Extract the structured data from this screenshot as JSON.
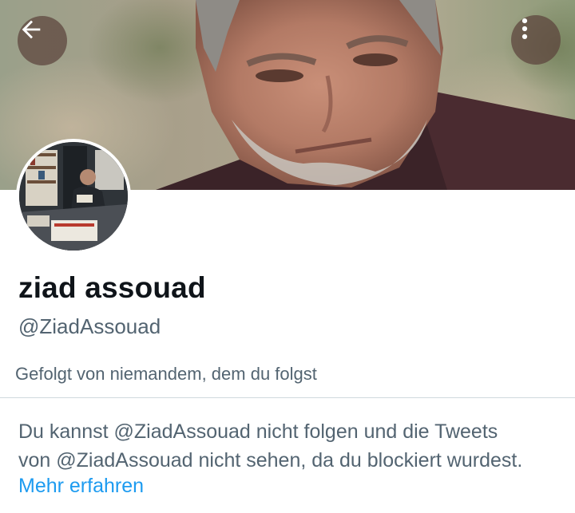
{
  "header": {
    "back_icon": "arrow-left-icon",
    "more_icon": "more-vertical-icon",
    "button_bg_color": "#5c423c"
  },
  "profile": {
    "display_name": "ziad assouad",
    "handle": "@ZiadAssouad",
    "followed_by": "Gefolgt von niemandem, dem du folgst"
  },
  "blocked_notice": {
    "line1": "Du kannst @ZiadAssouad nicht folgen und die Tweets",
    "line2": "von @ZiadAssouad nicht sehen, da du blockiert wurdest.",
    "link_label": "Mehr erfahren"
  },
  "colors": {
    "text_primary": "#0f1419",
    "text_secondary": "#536471",
    "link": "#1d9bf0",
    "divider": "#cfd9de"
  }
}
